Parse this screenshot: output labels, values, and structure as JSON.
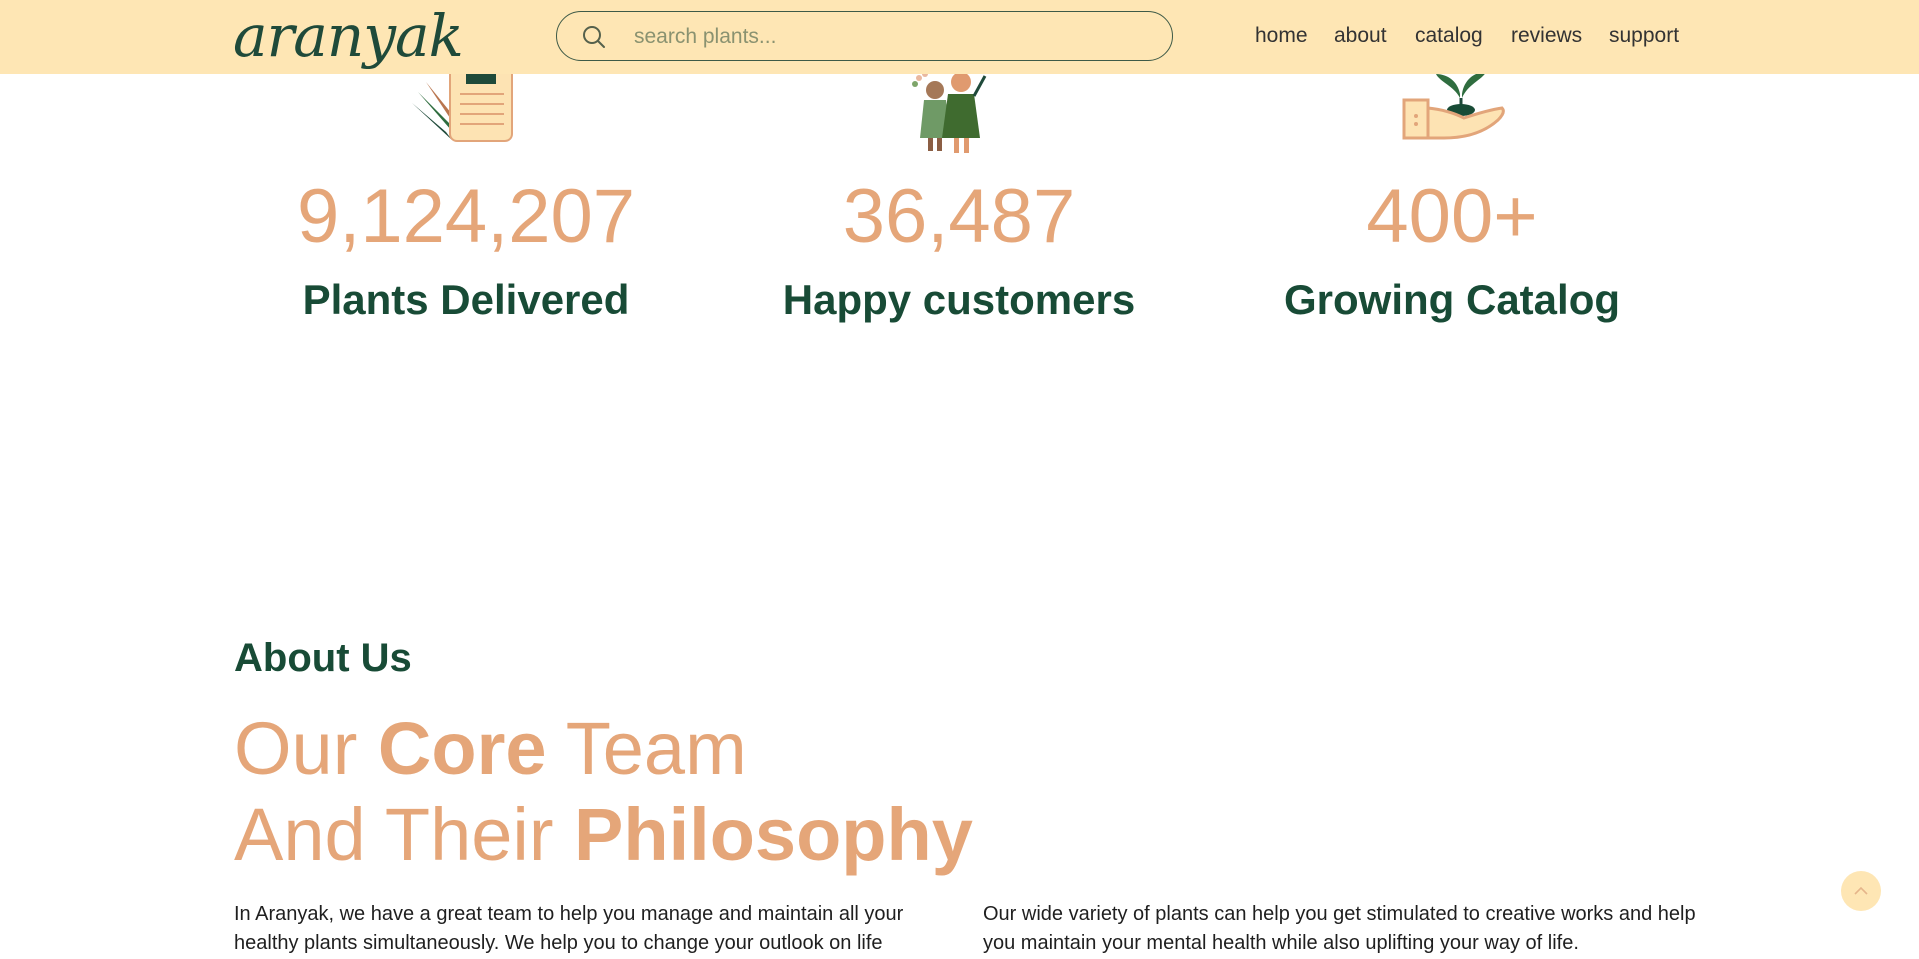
{
  "header": {
    "logo_text": "aranyak",
    "search": {
      "placeholder": "search plants...",
      "value": ""
    },
    "nav": [
      "home",
      "about",
      "catalog",
      "reviews",
      "support"
    ]
  },
  "stats": [
    {
      "value": "9,124,207",
      "label": "Plants Delivered",
      "icon": "catalog-leaflet-icon"
    },
    {
      "value": "36,487",
      "label": "Happy customers",
      "icon": "happy-customers-icon"
    },
    {
      "value": "400+",
      "label": "Growing Catalog",
      "icon": "hand-plant-icon"
    }
  ],
  "about": {
    "heading": "About Us",
    "title_line1": {
      "pre": "Our ",
      "bold": "Core",
      "post": " Team"
    },
    "title_line2": {
      "pre": "And Their ",
      "bold": "Philosophy"
    },
    "para1": "In Aranyak, we have a great team to help you manage and maintain all your healthy plants simultaneously. We help you to change your outlook on life",
    "para2": "Our wide variety of plants can help you get stimulated to creative works and help you maintain your mental health while also uplifting your way of life."
  },
  "colors": {
    "header_bg": "#fee6b4",
    "accent_peach": "#e5a679",
    "dark_green": "#184b36"
  }
}
